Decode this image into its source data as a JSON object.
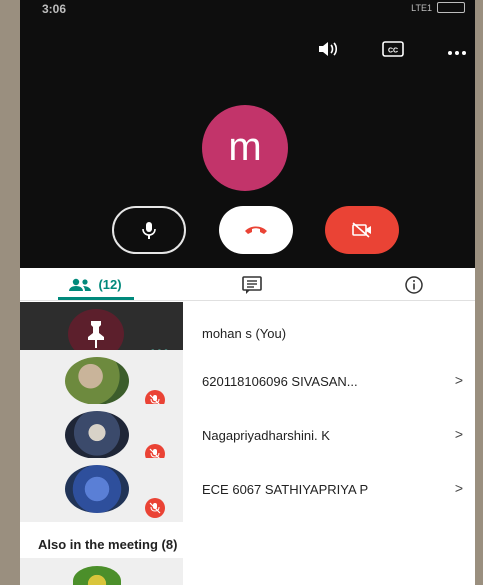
{
  "status": {
    "time": "3:06",
    "right": "LTE1"
  },
  "call": {
    "avatar_letter": "m"
  },
  "tabs": {
    "people_count": "(12)"
  },
  "participants": [
    {
      "name": "mohan s (You)",
      "pinned": true
    },
    {
      "name": "620118106096 SIVASAN...",
      "muted": true
    },
    {
      "name": "Nagapriyadharshini. K",
      "muted": true
    },
    {
      "name": "ECE 6067 SATHIYAPRIYA P",
      "muted": true
    }
  ],
  "section": {
    "also_in_meeting": "Also in the meeting (8)"
  },
  "colors": {
    "accent": "#00897b",
    "avatar": "#c2346a",
    "red": "#ea4335"
  }
}
